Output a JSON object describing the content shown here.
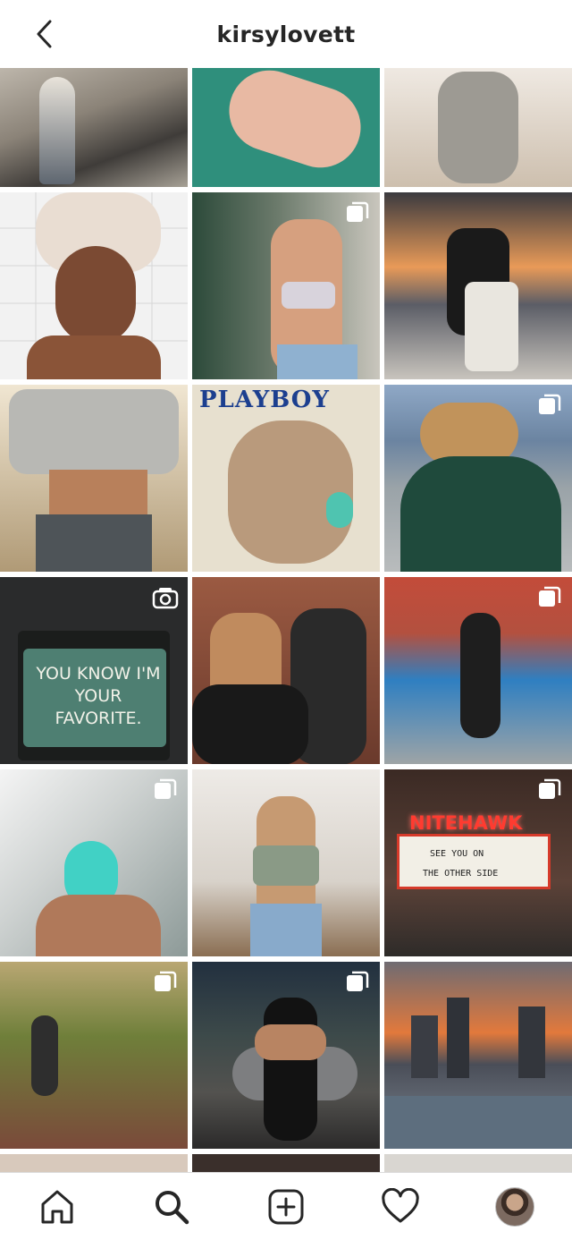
{
  "header": {
    "username": "kirsylovett",
    "back_icon": "chevron-left-icon"
  },
  "grid": {
    "posts": [
      {
        "id": "p1",
        "badge": null
      },
      {
        "id": "p2",
        "badge": null
      },
      {
        "id": "p3",
        "badge": null
      },
      {
        "id": "p4",
        "badge": null
      },
      {
        "id": "p5",
        "badge": "carousel-icon"
      },
      {
        "id": "p6",
        "badge": null
      },
      {
        "id": "p7",
        "badge": null
      },
      {
        "id": "p8",
        "badge": null,
        "caption": "PLAYBOY"
      },
      {
        "id": "p9",
        "badge": "carousel-icon"
      },
      {
        "id": "p10",
        "badge": "reel-icon",
        "caption": "YOU KNOW I'M YOUR FAVORITE."
      },
      {
        "id": "p11",
        "badge": null
      },
      {
        "id": "p12",
        "badge": "carousel-icon"
      },
      {
        "id": "p13",
        "badge": "carousel-icon"
      },
      {
        "id": "p14",
        "badge": null
      },
      {
        "id": "p15",
        "badge": "carousel-icon",
        "caption": "NITEHAWK",
        "marquee_lines": [
          "SEE  YOU  ON",
          "THE  OTHER  SIDE"
        ]
      },
      {
        "id": "p16",
        "badge": "carousel-icon"
      },
      {
        "id": "p17",
        "badge": "carousel-icon"
      },
      {
        "id": "p18",
        "badge": null
      }
    ]
  },
  "bottom_nav": {
    "items": [
      {
        "name": "home",
        "icon": "home-icon"
      },
      {
        "name": "search",
        "icon": "search-icon",
        "active": true
      },
      {
        "name": "new-post",
        "icon": "add-post-icon"
      },
      {
        "name": "activity",
        "icon": "heart-icon"
      },
      {
        "name": "profile",
        "icon": "profile-avatar"
      }
    ]
  },
  "colors": {
    "text_primary": "#262626",
    "divider": "#dbdbdb",
    "marquee_red": "#d63a2a"
  }
}
